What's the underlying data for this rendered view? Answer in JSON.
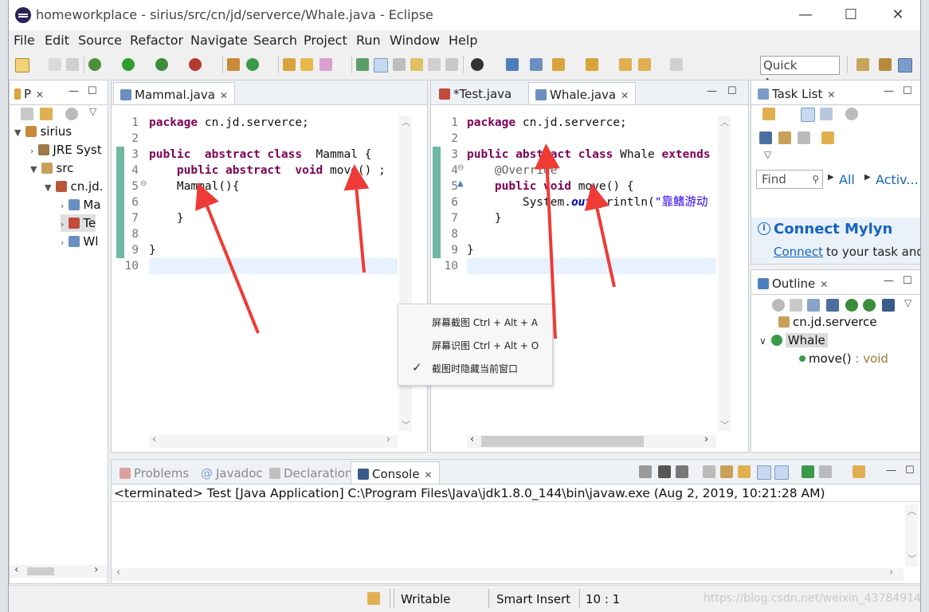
{
  "window": {
    "title": "homeworkplace - sirius/src/cn/jd/serverce/Whale.java - Eclipse",
    "minimize": "—",
    "maximize": "☐",
    "close": "✕"
  },
  "menu": [
    "File",
    "Edit",
    "Source",
    "Refactor",
    "Navigate",
    "Search",
    "Project",
    "Run",
    "Window",
    "Help"
  ],
  "toolbar": {
    "quick_access": "Quick Access"
  },
  "explorer": {
    "tab": "P",
    "items": [
      {
        "label": "sirius"
      },
      {
        "label": "JRE Syst"
      },
      {
        "label": "src"
      },
      {
        "label": "cn.jd."
      },
      {
        "label": "Ma"
      },
      {
        "label": "Te"
      },
      {
        "label": "Wl"
      }
    ]
  },
  "editor_left": {
    "tab": "Mammal.java",
    "line_numbers": [
      "1",
      "2",
      "3",
      "4",
      "5",
      "6",
      "7",
      "8",
      "9",
      "10"
    ]
  },
  "editor_right": {
    "tab_test": "*Test.java",
    "tab_whale": "Whale.java",
    "line_numbers": [
      "1",
      "2",
      "3",
      "4",
      "5",
      "6",
      "7",
      "8",
      "9",
      "10"
    ],
    "string_literal": "\"靠鳍游动"
  },
  "context_menu": {
    "items": [
      "屏幕截图 Ctrl + Alt + A",
      "屏幕识图 Ctrl + Alt + O",
      "截图时隐藏当前窗口"
    ],
    "check": "✓"
  },
  "tasklist": {
    "tab": "Task List",
    "find": "Find",
    "all": "All",
    "activate": "Activ..."
  },
  "mylyn": {
    "title": "Connect Mylyn",
    "link": "Connect",
    "rest": "to your task and"
  },
  "outline": {
    "tab": "Outline",
    "package": "cn.jd.serverce",
    "class": "Whale",
    "method": "move()",
    "method_type": ": void"
  },
  "bottom": {
    "tabs": [
      "Problems",
      "Javadoc",
      "Declaration",
      "Console"
    ],
    "console_line": "<terminated> Test [Java Application] C:\\Program Files\\Java\\jdk1.8.0_144\\bin\\javaw.exe (Aug 2, 2019, 10:21:28 AM)"
  },
  "status": {
    "writable": "Writable",
    "insert_mode": "Smart Insert",
    "position": "10 : 1",
    "watermark": "https://blog.csdn.net/weixin_43784914"
  },
  "colors": {
    "keyword": "#7f0055",
    "annotation": "#646464",
    "string": "#2a00ff",
    "arrow": "#ee3b36",
    "link": "#1565c0"
  }
}
